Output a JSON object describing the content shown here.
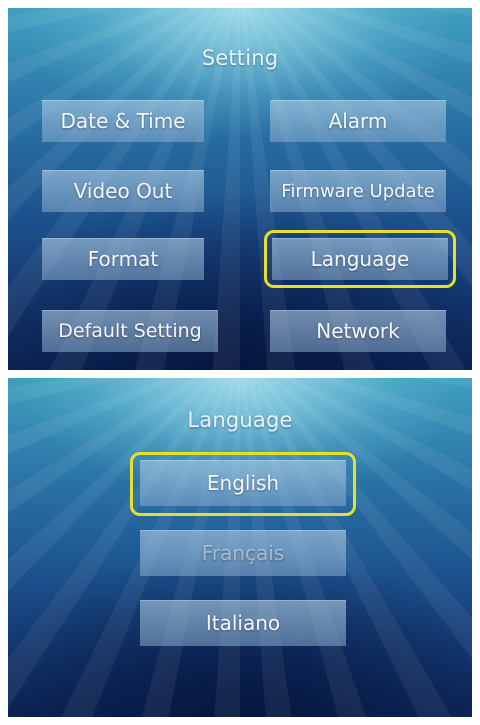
{
  "settings_screen": {
    "title": "Setting",
    "buttons": [
      {
        "label": "Date & Time"
      },
      {
        "label": "Alarm"
      },
      {
        "label": "Video Out"
      },
      {
        "label": "Firmware Update"
      },
      {
        "label": "Format"
      },
      {
        "label": "Language"
      },
      {
        "label": "Default Setting"
      },
      {
        "label": "Network"
      }
    ],
    "selected": "Language"
  },
  "language_screen": {
    "title": "Language",
    "options": [
      {
        "label": "English"
      },
      {
        "label": "Français"
      },
      {
        "label": "Italiano"
      }
    ],
    "selected": "English"
  },
  "colors": {
    "highlight": "#e6df2c",
    "button_fill": "#9fbcd6",
    "background_deep": "#12346c"
  }
}
